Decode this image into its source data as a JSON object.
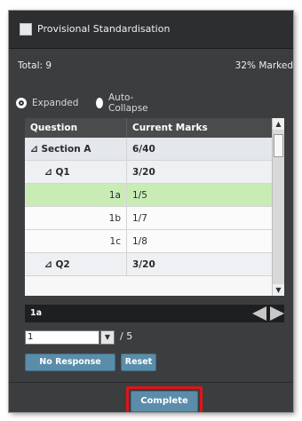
{
  "header": {
    "title": "Provisional Standardisation"
  },
  "summary": {
    "total": "Total: 9",
    "marked": "32% Marked"
  },
  "view_mode": {
    "expanded": "Expanded",
    "auto_collapse": "Auto-Collapse",
    "selected": "Expanded"
  },
  "table": {
    "headers": [
      "Question",
      "Current Marks"
    ],
    "rows": [
      {
        "question": "⊿ Section A",
        "marks": "6/40"
      },
      {
        "question": "⊿ Q1",
        "marks": "3/20"
      },
      {
        "question": "1a",
        "marks": "1/5"
      },
      {
        "question": "1b",
        "marks": "1/7"
      },
      {
        "question": "1c",
        "marks": "1/8"
      },
      {
        "question": "⊿ Q2",
        "marks": "3/20"
      }
    ]
  },
  "selected_item": "1a",
  "mark_entry": {
    "value": "1",
    "total": "/ 5"
  },
  "buttons": {
    "no_response": "No Response",
    "reset": "Reset",
    "complete": "Complete"
  },
  "colors": {
    "selected_row": "#c9ecb6",
    "button": "#5b8daa",
    "highlight": "#e01418"
  }
}
